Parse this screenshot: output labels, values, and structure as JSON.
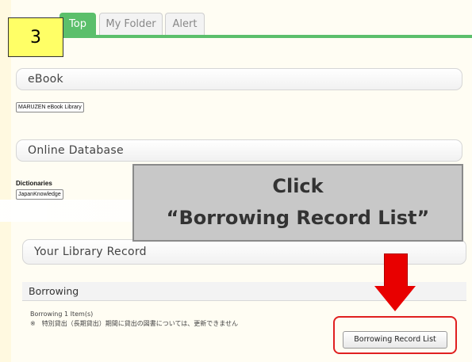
{
  "tabs": [
    {
      "label": "Top",
      "active": true
    },
    {
      "label": "My Folder",
      "active": false
    },
    {
      "label": "Alert",
      "active": false
    }
  ],
  "step_number": "3",
  "sections": {
    "ebook": {
      "title": "eBook",
      "links": [
        "MARUZEN eBook Library"
      ]
    },
    "online_database": {
      "title": "Online Database",
      "group_label": "Dictionaries",
      "links": [
        "JapanKnowledge"
      ]
    },
    "library_record": {
      "title": "Your Library Record"
    }
  },
  "callout": {
    "line1": "Click",
    "line2": "“Borrowing Record List”"
  },
  "borrowing": {
    "header": "Borrowing",
    "count_text": "Borrowing 1 Item(s)",
    "note": "※　特別貸出（長期貸出）期間に貸出の図書については、更新できません",
    "button_label": "Borrowing Record List"
  },
  "colors": {
    "accent_green": "#5bbf6b",
    "step_yellow": "#ffff66",
    "arrow_red": "#e80000",
    "callout_gray": "#c8c8c8"
  }
}
